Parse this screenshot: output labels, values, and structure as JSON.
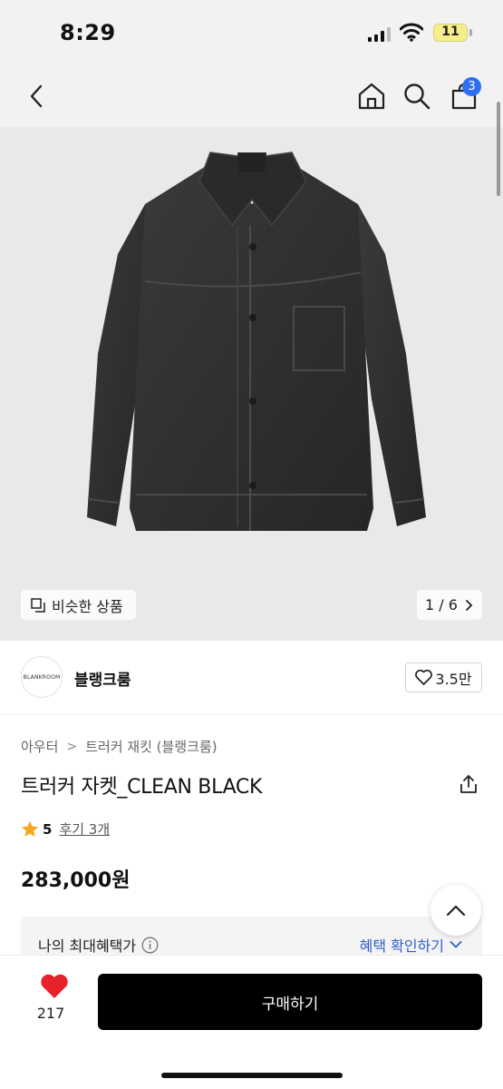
{
  "status_bar": {
    "time": "8:29",
    "battery": "11"
  },
  "header": {
    "cart_count": "3"
  },
  "gallery": {
    "similar_label": "비슷한 상품",
    "page_counter": "1 / 6"
  },
  "brand": {
    "logo_text": "BLANKROOM",
    "name": "블랭크룸",
    "likes": "3.5만"
  },
  "product": {
    "breadcrumb": [
      "아우터",
      "트러커 재킷 (블랭크룸)"
    ],
    "title": "트러커 자켓_CLEAN BLACK",
    "rating": "5",
    "reviews": "후기 3개",
    "price": "283,000원"
  },
  "benefit": {
    "label": "나의 최대혜택가",
    "link": "혜택 확인하기"
  },
  "bottom": {
    "heart_count": "217",
    "buy_label": "구매하기"
  },
  "colors": {
    "accent_blue": "#2e6ff1",
    "heart_red": "#e8222b",
    "buy_button": "#000000",
    "star": "#f5a623"
  },
  "icons": [
    "back-icon",
    "home-icon",
    "search-icon",
    "cart-icon",
    "similar-icon",
    "chevron-right-icon",
    "heart-outline-icon",
    "share-icon",
    "star-icon",
    "chevron-up-icon",
    "info-icon",
    "chevron-down-icon",
    "heart-filled-icon"
  ]
}
